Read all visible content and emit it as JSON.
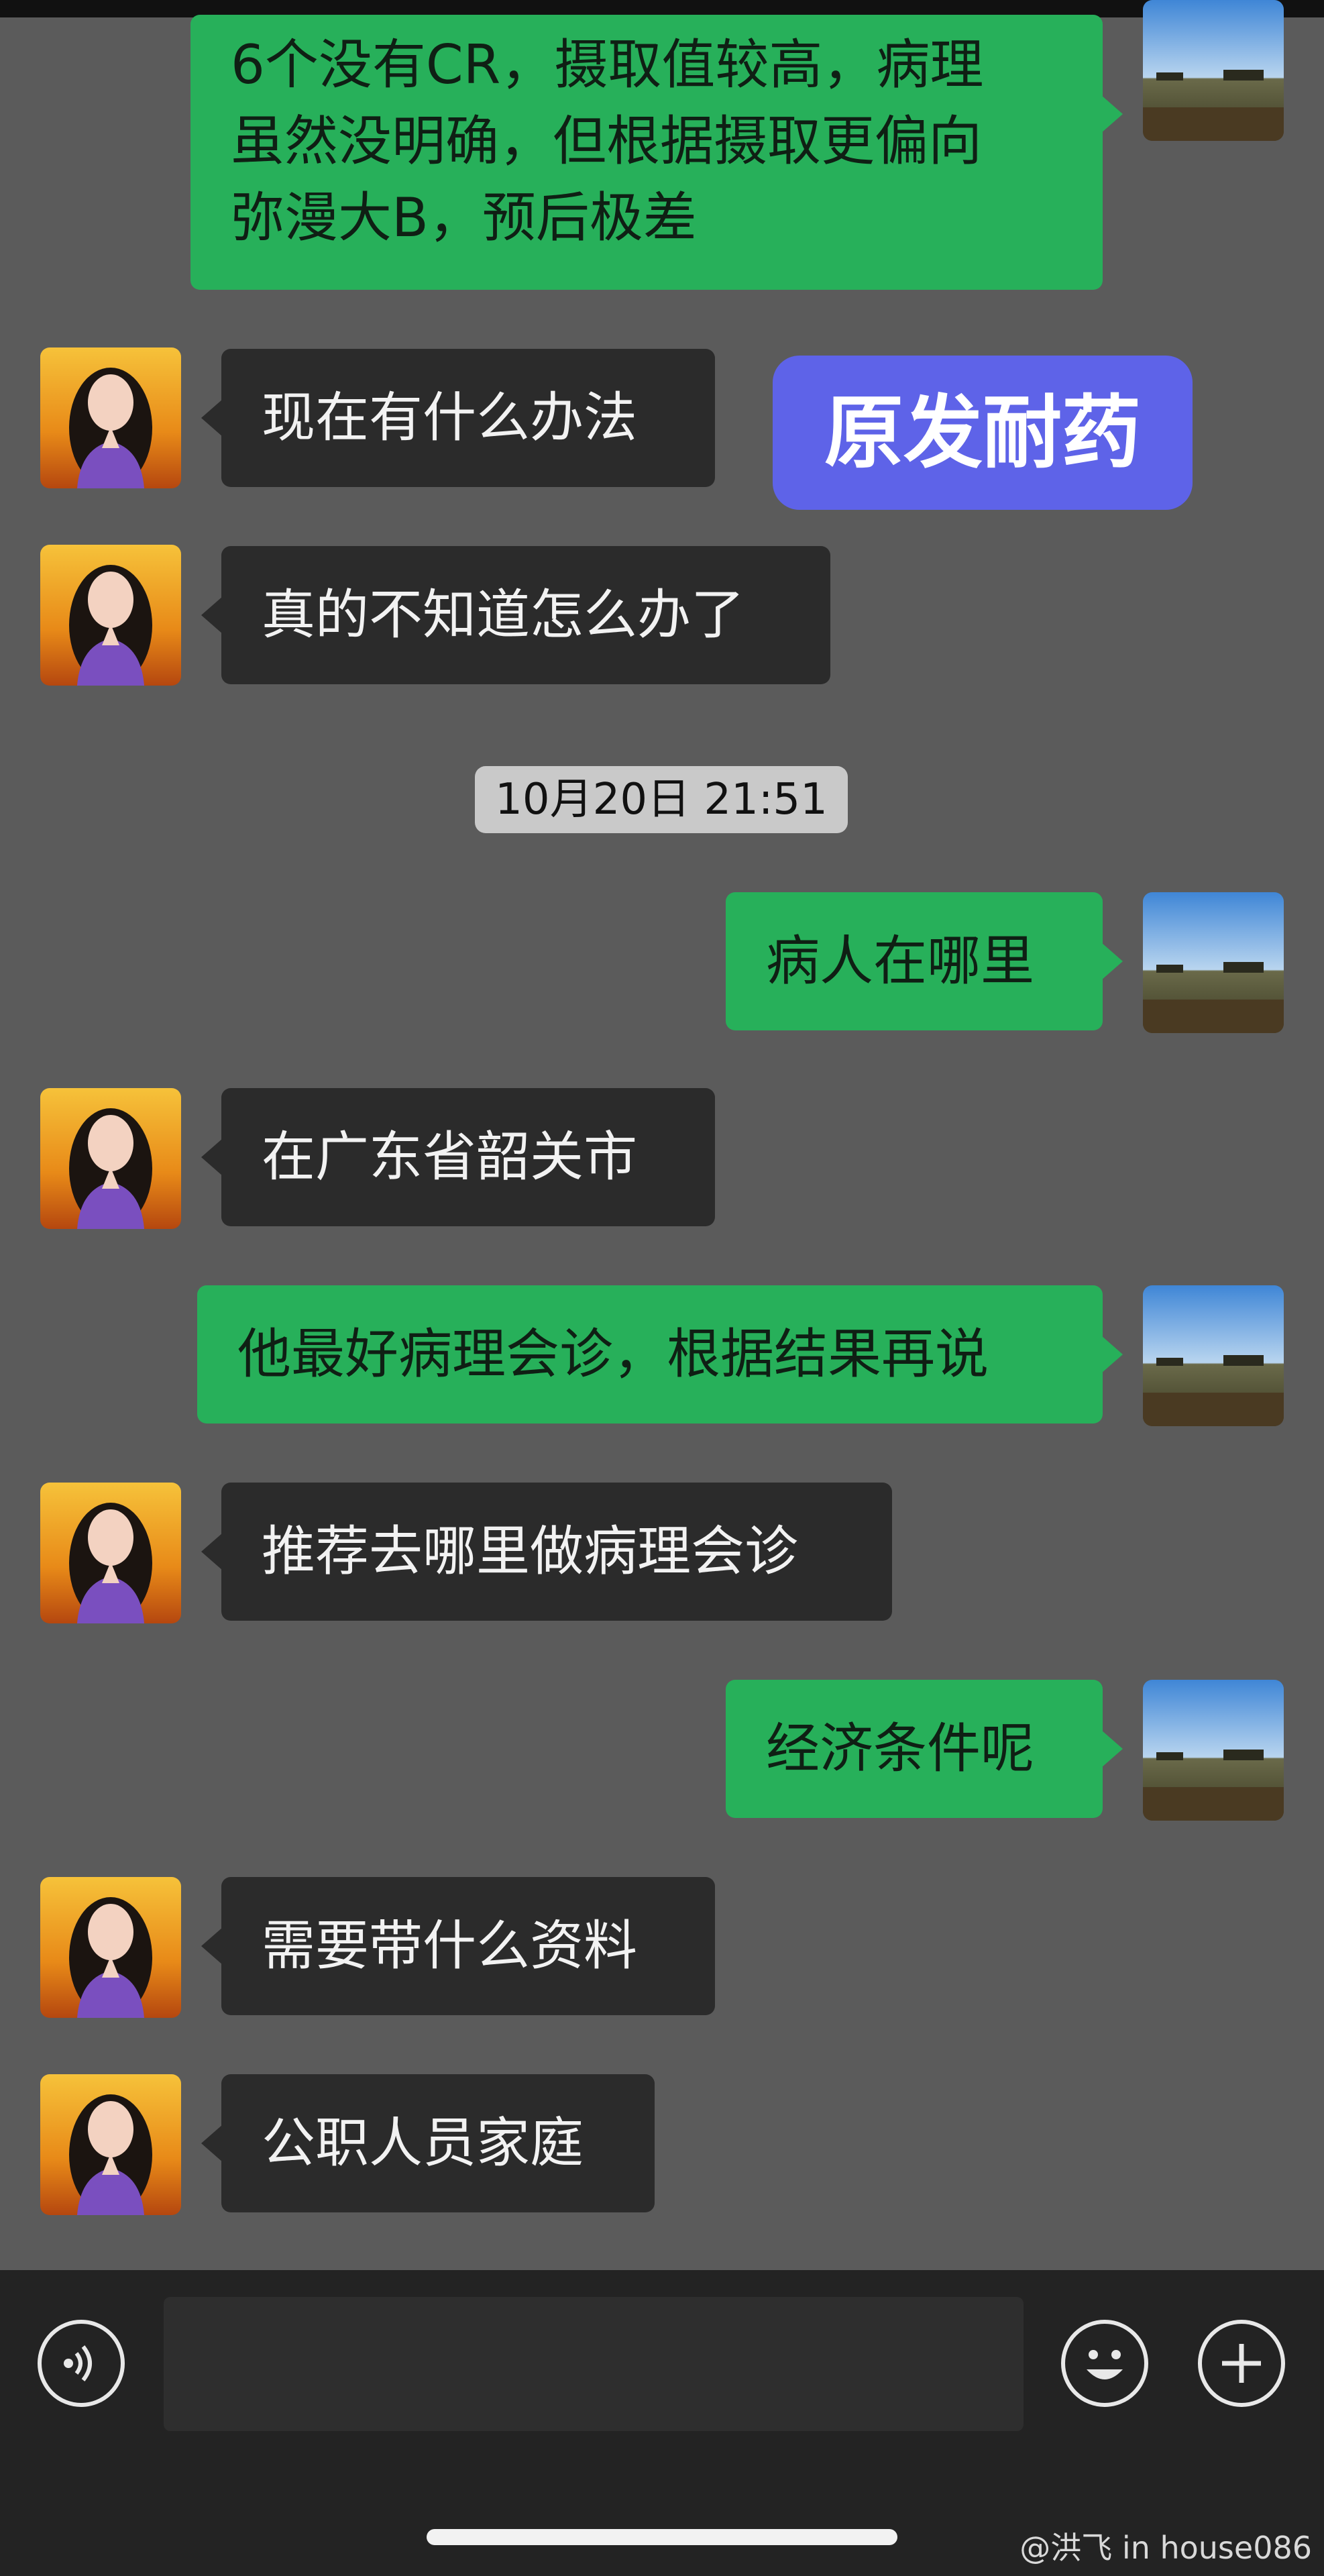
{
  "overlay": {
    "sticker_text": "原发耐药",
    "watermark": "@洪飞 in house086"
  },
  "timestamp": "10月20日 21:51",
  "messages": [
    {
      "side": "me",
      "lines": [
        "6个没有CR，摄取值较高，病理",
        "虽然没明确，但根据摄取更偏向",
        "弥漫大B，预后极差"
      ]
    },
    {
      "side": "her",
      "text": "现在有什么办法"
    },
    {
      "side": "her",
      "text": "真的不知道怎么办了"
    },
    {
      "side": "me",
      "text": "病人在哪里"
    },
    {
      "side": "her",
      "text": "在广东省韶关市"
    },
    {
      "side": "me",
      "text": "他最好病理会诊，根据结果再说"
    },
    {
      "side": "her",
      "text": "推荐去哪里做病理会诊"
    },
    {
      "side": "me",
      "text": "经济条件呢"
    },
    {
      "side": "her",
      "text": "需要带什么资料"
    },
    {
      "side": "her",
      "text": "公职人员家庭"
    }
  ],
  "input_bar": {
    "voice_icon": "voice-icon",
    "emoji_icon": "smiley-icon",
    "more_icon": "plus-icon",
    "message_value": ""
  }
}
